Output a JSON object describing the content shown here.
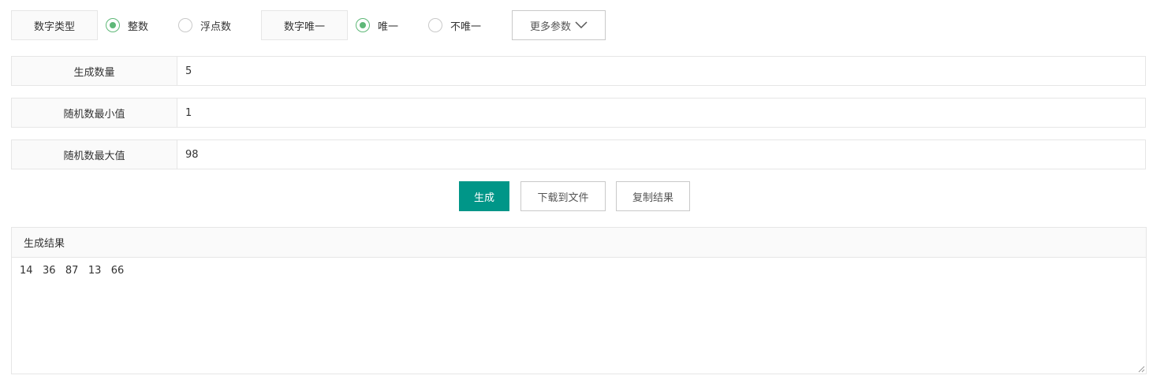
{
  "options": {
    "number_type": {
      "label": "数字类型",
      "choices": [
        {
          "label": "整数",
          "checked": true
        },
        {
          "label": "浮点数",
          "checked": false
        }
      ]
    },
    "uniqueness": {
      "label": "数字唯一",
      "choices": [
        {
          "label": "唯一",
          "checked": true
        },
        {
          "label": "不唯一",
          "checked": false
        }
      ]
    },
    "more_params_label": "更多参数",
    "more_params_icon": "chevron-down-icon"
  },
  "fields": {
    "count": {
      "label": "生成数量",
      "value": "5"
    },
    "min": {
      "label": "随机数最小值",
      "value": "1"
    },
    "max": {
      "label": "随机数最大值",
      "value": "98"
    }
  },
  "actions": {
    "generate_label": "生成",
    "download_label": "下载到文件",
    "copy_label": "复制结果"
  },
  "result": {
    "title": "生成结果",
    "text": "14   36   87   13   66"
  },
  "colors": {
    "primary": "#009688",
    "radio_checked": "#5fb878",
    "border": "#e6e6e6",
    "label_bg": "#fafafa"
  }
}
